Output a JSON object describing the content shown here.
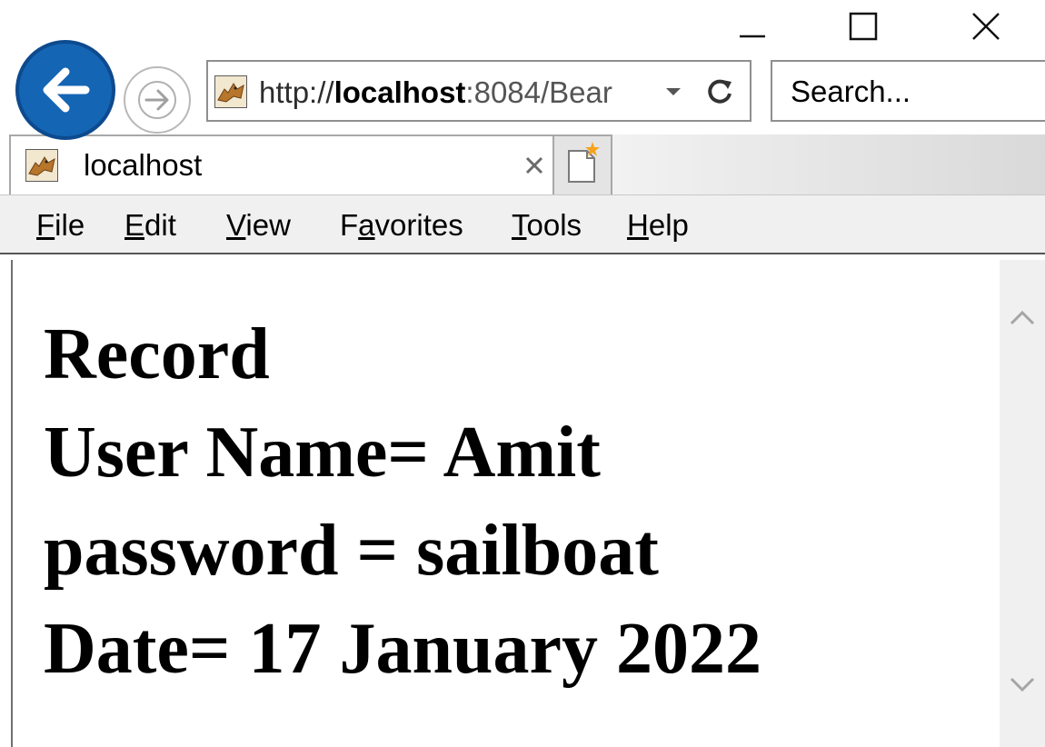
{
  "window": {
    "controls": {
      "minimize_icon": "minimize-icon",
      "maximize_icon": "maximize-icon",
      "close_icon": "close-icon"
    }
  },
  "nav": {
    "back_icon": "back-arrow-icon",
    "forward_icon": "forward-arrow-icon",
    "address": {
      "scheme": "http://",
      "host": "localhost",
      "rest": ":8084/Bear"
    },
    "refresh_icon": "refresh-icon",
    "dropdown_icon": "chevron-down-icon",
    "search": {
      "placeholder": "Search..."
    }
  },
  "tabs": [
    {
      "label": "localhost",
      "icon": "tomcat-favicon"
    }
  ],
  "new_tab_icon": "new-tab-icon",
  "menu": {
    "items": [
      {
        "access_key": "F",
        "rest": "ile"
      },
      {
        "access_key": "E",
        "rest": "dit"
      },
      {
        "access_key": "V",
        "rest": "iew"
      },
      {
        "pre": "F",
        "access_key": "a",
        "rest": "vorites"
      },
      {
        "access_key": "T",
        "rest": "ools"
      },
      {
        "access_key": "H",
        "rest": "elp"
      }
    ]
  },
  "page": {
    "lines": [
      "Record",
      "User Name= Amit",
      "password = sailboat",
      "Date= 17 January 2022"
    ]
  },
  "colors": {
    "back_button": "#1565b5",
    "menubar": "#f0f0f0",
    "scrollbar": "#f0f0f0"
  }
}
